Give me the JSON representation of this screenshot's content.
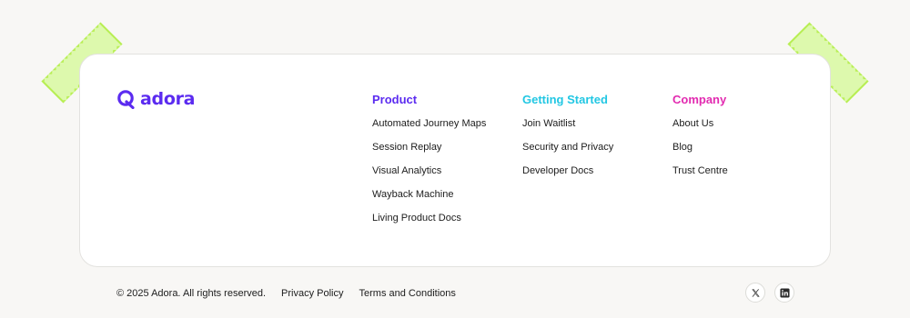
{
  "brand": {
    "name": "adora",
    "color": "#5b2bf0"
  },
  "columns": [
    {
      "title": "Product",
      "color": "#5b2bf0",
      "links": [
        "Automated Journey Maps",
        "Session Replay",
        "Visual Analytics",
        "Wayback Machine",
        "Living Product Docs"
      ]
    },
    {
      "title": "Getting Started",
      "color": "#22c7e3",
      "links": [
        "Join Waitlist",
        "Security and Privacy",
        "Developer Docs"
      ]
    },
    {
      "title": "Company",
      "color": "#e22ab0",
      "links": [
        "About Us",
        "Blog",
        "Trust Centre"
      ]
    }
  ],
  "footer": {
    "copyright": "© 2025 Adora. All rights reserved.",
    "privacy": "Privacy Policy",
    "terms": "Terms and Conditions"
  },
  "social": [
    {
      "icon": "x-twitter-icon"
    },
    {
      "icon": "linkedin-icon"
    }
  ],
  "tape_color": "#d8f9a0"
}
